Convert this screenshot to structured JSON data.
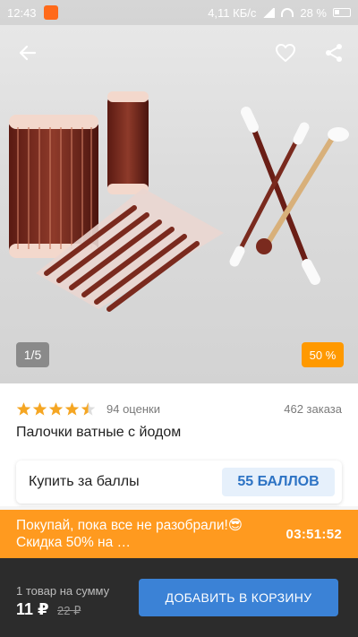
{
  "status_bar": {
    "time": "12:43",
    "network_speed": "4,11 КБ/с",
    "battery": "28 %"
  },
  "gallery": {
    "page_counter": "1/5",
    "discount_badge": "50 %"
  },
  "product": {
    "rating": 4.5,
    "rating_count": "94 оценки",
    "orders": "462 заказа",
    "title": "Палочки ватные с йодом"
  },
  "points": {
    "label": "Купить за баллы",
    "button_label": "55 БАЛЛОВ"
  },
  "promo": {
    "text": "Покупай, пока все не разобрали!😎 Скидка 50% на …",
    "timer": "03:51:52"
  },
  "bottom_bar": {
    "sum_label": "1 товар на сумму",
    "price": "11 ₽",
    "old_price": "22 ₽",
    "cart_button": "ДОБАВИТЬ В КОРЗИНУ"
  },
  "colors": {
    "accent_orange": "#ff9a1f",
    "star": "#f5a623",
    "primary_blue": "#3b82d6",
    "points_text": "#2d73c4"
  },
  "icons": [
    "back-arrow-icon",
    "heart-icon",
    "share-icon",
    "star-icon"
  ]
}
